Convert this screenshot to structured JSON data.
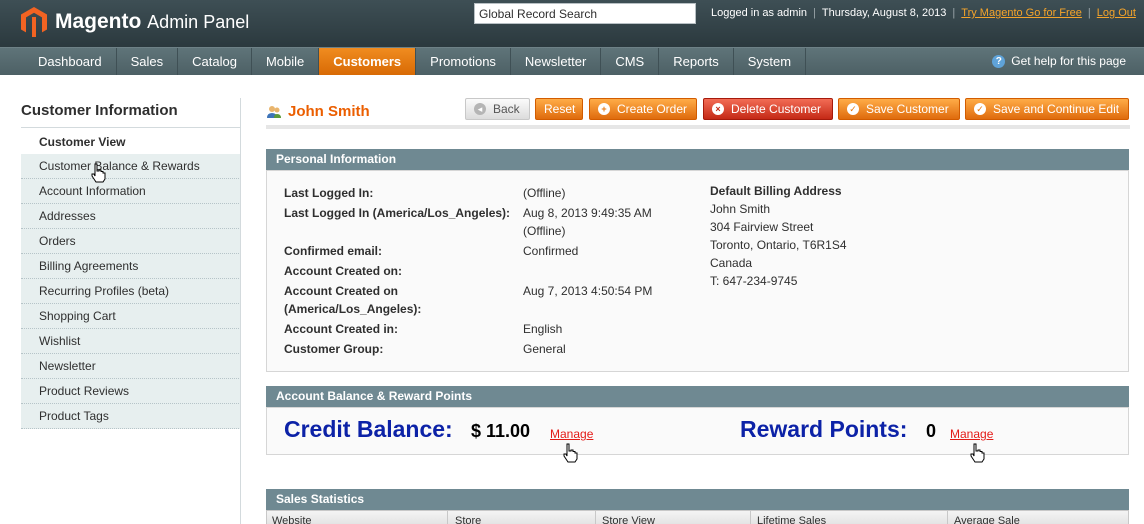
{
  "header": {
    "logo_main": "Magento",
    "logo_sub": "Admin Panel",
    "search_value": "Global Record Search",
    "logged_in": "Logged in as admin",
    "date": "Thursday, August 8, 2013",
    "try_link": "Try Magento Go for Free",
    "logout": "Log Out"
  },
  "nav": {
    "items": [
      "Dashboard",
      "Sales",
      "Catalog",
      "Mobile",
      "Customers",
      "Promotions",
      "Newsletter",
      "CMS",
      "Reports",
      "System"
    ],
    "active": "Customers",
    "help": "Get help for this page"
  },
  "sidebar": {
    "title": "Customer Information",
    "items": [
      "Customer View",
      "Customer Balance & Rewards",
      "Account Information",
      "Addresses",
      "Orders",
      "Billing Agreements",
      "Recurring Profiles (beta)",
      "Shopping Cart",
      "Wishlist",
      "Newsletter",
      "Product Reviews",
      "Product Tags"
    ]
  },
  "page": {
    "customer_name": "John Smith",
    "buttons": {
      "back": "Back",
      "reset": "Reset",
      "create_order": "Create Order",
      "delete": "Delete Customer",
      "save": "Save Customer",
      "save_continue": "Save and Continue Edit"
    }
  },
  "personal": {
    "title": "Personal Information",
    "rows": [
      {
        "label": "Last Logged In:",
        "value": "(Offline)"
      },
      {
        "label": "Last Logged In (America/Los_Angeles):",
        "value": "Aug 8, 2013 9:49:35 AM",
        "value2": "(Offline)"
      },
      {
        "label": "Confirmed email:",
        "value": "Confirmed"
      },
      {
        "label": "Account Created on:",
        "value": ""
      },
      {
        "label": "Account Created on",
        "label2": "(America/Los_Angeles):",
        "value": "Aug 7, 2013 4:50:54 PM"
      },
      {
        "label": "Account Created in:",
        "value": "English"
      },
      {
        "label": "Customer Group:",
        "value": "General"
      }
    ],
    "address_title": "Default Billing Address",
    "address_lines": [
      "John Smith",
      "304 Fairview Street",
      "Toronto, Ontario, T6R1S4",
      "Canada",
      "T: 647-234-9745"
    ]
  },
  "balance": {
    "title": "Account Balance & Reward Points",
    "credit_label": "Credit Balance:",
    "credit_value": "$ 11.00",
    "reward_label": "Reward Points:",
    "reward_value": "0",
    "manage": "Manage"
  },
  "stats": {
    "title": "Sales Statistics",
    "columns": [
      "Website",
      "Store",
      "Store View",
      "Lifetime Sales",
      "Average Sale"
    ]
  }
}
